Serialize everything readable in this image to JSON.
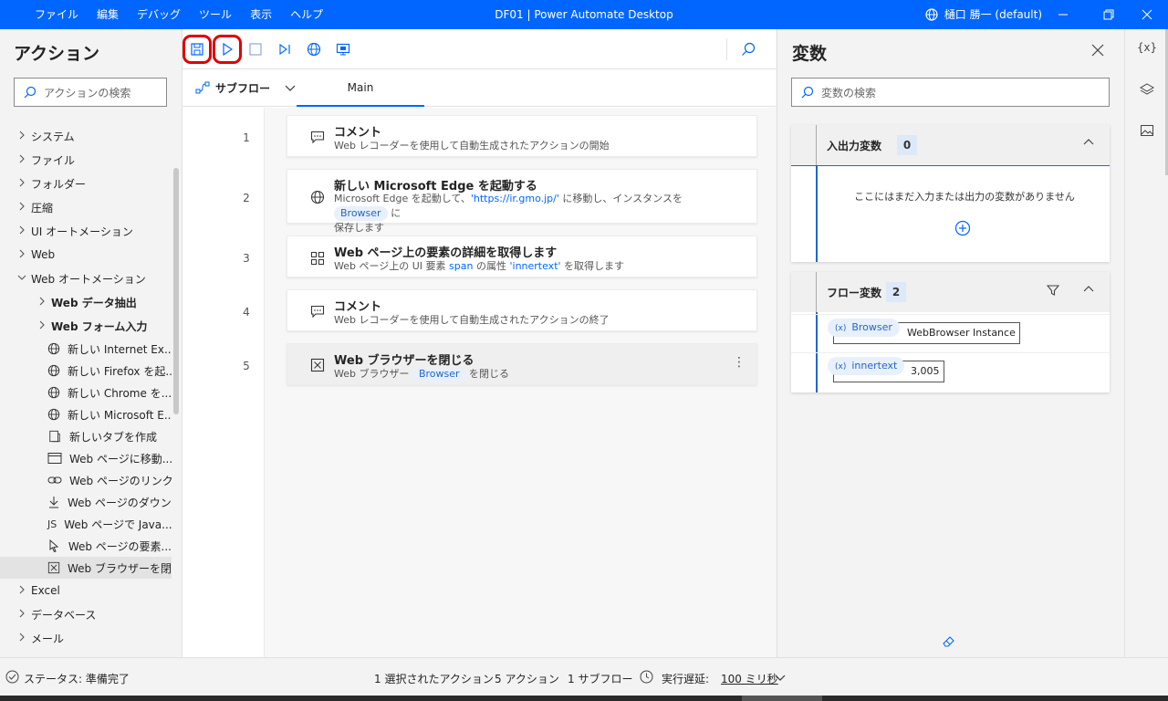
{
  "titlebar": {
    "menu": [
      "ファイル",
      "編集",
      "デバッグ",
      "ツール",
      "表示",
      "ヘルプ"
    ],
    "title": "DF01 | Power Automate Desktop",
    "user": "樋口 勝一 (default)"
  },
  "actions": {
    "title": "アクション",
    "search_placeholder": "アクションの検索",
    "items": [
      {
        "label": "システム",
        "type": "group"
      },
      {
        "label": "ファイル",
        "type": "group"
      },
      {
        "label": "フォルダー",
        "type": "group"
      },
      {
        "label": "圧縮",
        "type": "group"
      },
      {
        "label": "UI オートメーション",
        "type": "group"
      },
      {
        "label": "Web",
        "type": "group"
      },
      {
        "label": "Web オートメーション",
        "type": "group-open"
      },
      {
        "label": "Web データ抽出",
        "type": "subgroup"
      },
      {
        "label": "Web フォーム入力",
        "type": "subgroup"
      },
      {
        "label": "新しい Internet Ex...",
        "type": "action",
        "icon": "globe-icon"
      },
      {
        "label": "新しい Firefox を起...",
        "type": "action",
        "icon": "globe-icon"
      },
      {
        "label": "新しい Chrome を...",
        "type": "action",
        "icon": "globe-icon"
      },
      {
        "label": "新しい Microsoft E...",
        "type": "action",
        "icon": "globe-icon"
      },
      {
        "label": "新しいタブを作成",
        "type": "action",
        "icon": "new-tab-icon"
      },
      {
        "label": "Web ページに移動...",
        "type": "action",
        "icon": "browser-window-icon"
      },
      {
        "label": "Web ページのリンク...",
        "type": "action",
        "icon": "link-icon"
      },
      {
        "label": "Web ページのダウン...",
        "type": "action",
        "icon": "download-icon"
      },
      {
        "label": "Web ページで Java...",
        "type": "action",
        "icon": "js-icon"
      },
      {
        "label": "Web ページの要素...",
        "type": "action",
        "icon": "cursor-icon"
      },
      {
        "label": "Web ブラウザーを閉...",
        "type": "action",
        "icon": "close-box-icon",
        "selected": true
      },
      {
        "label": "Excel",
        "type": "group"
      },
      {
        "label": "データベース",
        "type": "group"
      },
      {
        "label": "メール",
        "type": "group"
      }
    ]
  },
  "toolbar": {
    "subflow_label": "サブフロー",
    "main_tab": "Main"
  },
  "flow": [
    {
      "num": "1",
      "title": "コメント",
      "icon": "comment-icon",
      "desc_parts": [
        {
          "t": "Web レコーダーを使用して自動生成されたアクションの開始",
          "blue": true
        }
      ]
    },
    {
      "num": "2",
      "title": "新しい Microsoft Edge を起動する",
      "icon": "globe-icon",
      "desc_a": "Microsoft Edge を起動して、",
      "desc_url": "'https://ir.gmo.jp/'",
      "desc_b": " に移動し、インスタンスを ",
      "desc_chip": "Browser",
      "desc_c": " に",
      "desc_d": "保存します"
    },
    {
      "num": "3",
      "title": "Web ページ上の要素の詳細を取得します",
      "icon": "element-icon",
      "desc_a": "Web ページ上の UI 要素 ",
      "desc_span": "span",
      "desc_b": " の属性 ",
      "desc_attr": "'innertext'",
      "desc_c": " を取得します"
    },
    {
      "num": "4",
      "title": "コメント",
      "icon": "comment-icon",
      "desc": "Web レコーダーを使用して自動生成されたアクションの終了"
    },
    {
      "num": "5",
      "title": "Web ブラウザーを閉じる",
      "icon": "close-box-icon",
      "desc_a": "Web ブラウザー ",
      "desc_chip": "Browser",
      "desc_b": " を閉じる"
    }
  ],
  "variables": {
    "title": "変数",
    "search_placeholder": "変数の検索",
    "io": {
      "title": "入出力変数",
      "count": "0",
      "empty_text": "ここにはまだ入力または出力の変数がありません"
    },
    "flowvars": {
      "title": "フロー変数",
      "count": "2",
      "items": [
        {
          "name": "Browser",
          "value": "WebBrowser Instance"
        },
        {
          "name": "innertext",
          "value": "3,005"
        }
      ]
    }
  },
  "status": {
    "state": "ステータス: 準備完了",
    "selected": "1 選択されたアクション",
    "actions": "5 アクション",
    "subflows": "1 サブフロー",
    "delay_label": "実行遅延:",
    "delay_value": "100 ミリ秒"
  }
}
